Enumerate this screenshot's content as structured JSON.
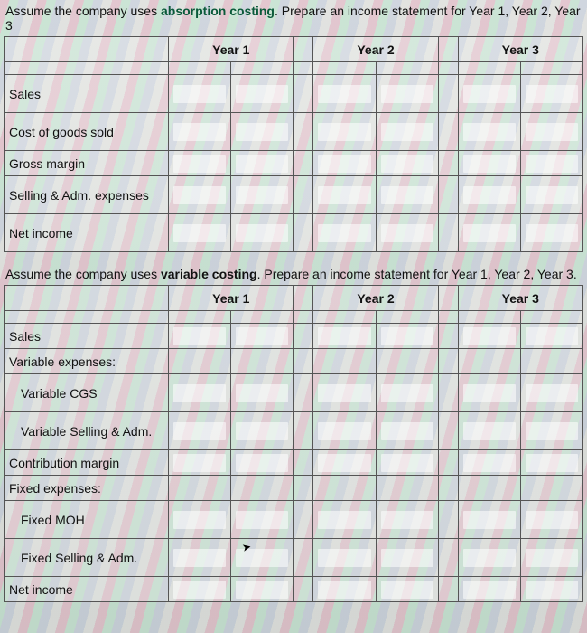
{
  "section1": {
    "instruction_pre": "Assume the company uses ",
    "instruction_method": "absorption costing",
    "instruction_post": ". Prepare an income statement for Year 1, Year 2, Year 3",
    "headers": {
      "c1": "Year 1",
      "c2": "Year 2",
      "c3": "Year 3"
    },
    "rows": [
      {
        "label": "Sales"
      },
      {
        "label": "Cost of goods sold"
      },
      {
        "label": "Gross margin"
      },
      {
        "label": "Selling & Adm. expenses"
      },
      {
        "label": "Net income"
      }
    ]
  },
  "section2": {
    "instruction_pre": "Assume the company uses ",
    "instruction_method": "variable costing",
    "instruction_post": ". Prepare an income statement for Year 1, Year 2, Year 3.",
    "headers": {
      "c1": "Year 1",
      "c2": "Year 2",
      "c3": "Year 3"
    },
    "rows": [
      {
        "label": "Sales"
      },
      {
        "label": "Variable expenses:"
      },
      {
        "label": "Variable CGS",
        "indent": true
      },
      {
        "label": "Variable Selling & Adm.",
        "indent": true
      },
      {
        "label": "Contribution margin"
      },
      {
        "label": "Fixed expenses:"
      },
      {
        "label": "Fixed MOH",
        "indent": true
      },
      {
        "label": "Fixed Selling & Adm.",
        "indent": true
      },
      {
        "label": "Net income"
      }
    ]
  }
}
